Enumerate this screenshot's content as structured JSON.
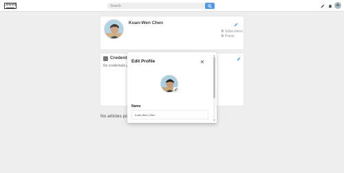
{
  "header": {
    "logo_text": "LOGOS",
    "search_placeholder": "Search",
    "icons": [
      "search-icon",
      "pencil-icon",
      "bell-icon",
      "avatar"
    ]
  },
  "profile": {
    "name": "Kuan-Wen Chen",
    "subscribers_count": "0",
    "subscribers_label": "Subscribers",
    "points_count": "0",
    "points_label": "Points"
  },
  "credentials": {
    "title": "Credentials",
    "empty_text": "No credentials yet"
  },
  "articles": {
    "empty_text": "No articles posted"
  },
  "modal": {
    "title": "Edit Profile",
    "name_label": "Name",
    "name_value": "Kuan-Wen Chen"
  },
  "colors": {
    "accent": "#3d8bd9",
    "pencil": "#2a87d4",
    "background": "#ececec"
  }
}
